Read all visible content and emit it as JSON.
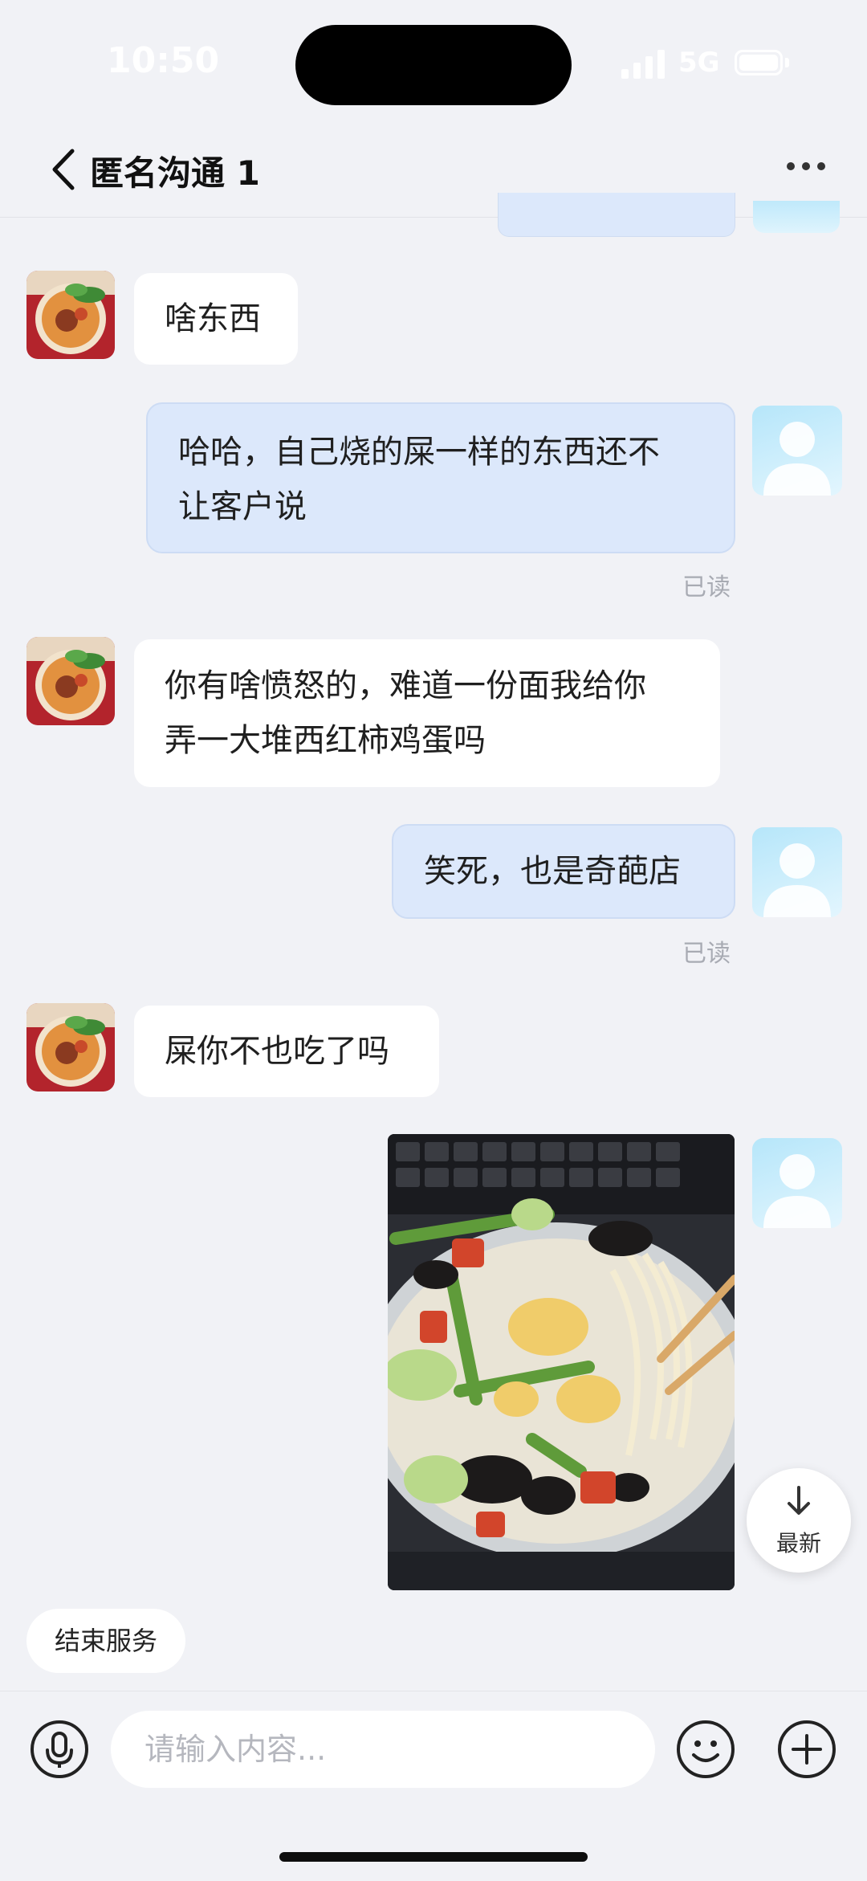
{
  "status_bar": {
    "time": "10:50",
    "network": "5G"
  },
  "header": {
    "title": "匿名沟通 1"
  },
  "messages": [
    {
      "side": "in",
      "text": "啥东西"
    },
    {
      "side": "out",
      "lines": [
        "哈哈，自己烧的屎一样的东西还不",
        "让客户说"
      ],
      "status": "已读"
    },
    {
      "side": "in",
      "lines": [
        "你有啥愤怒的，难道一份面我给你",
        "弄一大堆西红柿鸡蛋吗"
      ]
    },
    {
      "side": "out",
      "text": "笑死，也是奇葩店",
      "status": "已读"
    },
    {
      "side": "in",
      "text": "屎你不也吃了吗"
    },
    {
      "side": "out",
      "type": "image"
    }
  ],
  "latest_button": {
    "label": "最新"
  },
  "end_service": {
    "label": "结束服务"
  },
  "input": {
    "placeholder": "请输入内容..."
  },
  "icons": [
    "back-chevron-icon",
    "more-icon",
    "microphone-icon",
    "emoji-icon",
    "plus-icon",
    "arrow-down-icon"
  ],
  "colors": {
    "background": "#f1f2f6",
    "incoming_bubble": "#ffffff",
    "outgoing_bubble": "#dce8fb"
  }
}
